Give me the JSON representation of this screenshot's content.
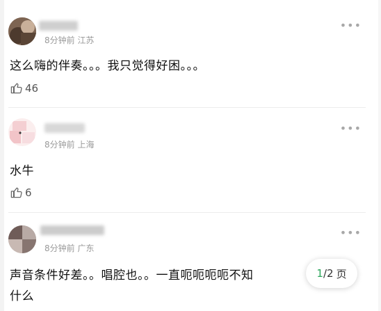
{
  "comments": [
    {
      "meta": "8分钟前 江苏",
      "text": "这么嗨的伴奏。。。我只觉得好困。。。",
      "likes": "46"
    },
    {
      "meta": "8分钟前 上海",
      "text": "水牛",
      "likes": "6"
    },
    {
      "meta": "8分钟前 广东",
      "text_line1": "声音条件好差。。唱腔也。。一直呃呃呃呃不知",
      "text_line2": "什么"
    }
  ],
  "pager": {
    "current": "1",
    "total": "/2",
    "unit": "页"
  },
  "icons": {
    "more": "more-dots-icon",
    "like": "thumb-up-icon"
  }
}
